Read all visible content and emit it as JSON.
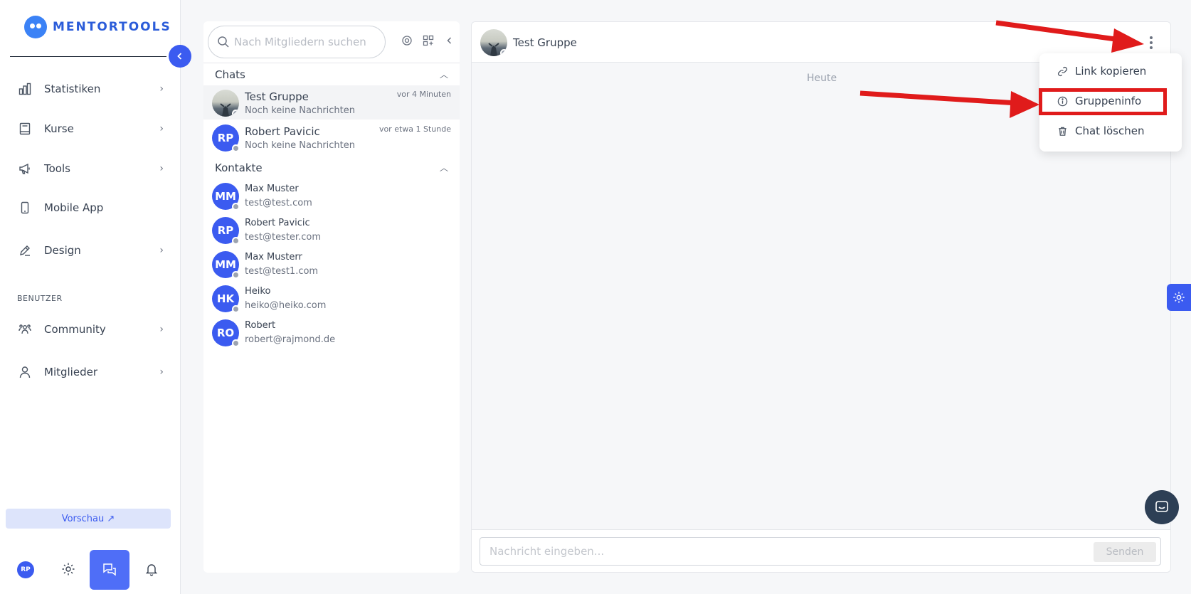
{
  "brand": {
    "name": "MENTORTOOLS"
  },
  "sidebar": {
    "items": [
      {
        "label": "Statistiken",
        "icon": "bar-chart-icon",
        "chevron": true
      },
      {
        "label": "Kurse",
        "icon": "book-icon",
        "chevron": true
      },
      {
        "label": "Tools",
        "icon": "megaphone-icon",
        "chevron": true
      },
      {
        "label": "Mobile App",
        "icon": "phone-icon",
        "chevron": false
      },
      {
        "label": "Design",
        "icon": "pencil-icon",
        "chevron": true
      },
      {
        "label": "Community",
        "icon": "users-icon",
        "chevron": true
      },
      {
        "label": "Mitglieder",
        "icon": "user-icon",
        "chevron": true
      }
    ],
    "section_label": "BENUTZER",
    "preview_label": "Vorschau ↗",
    "user_initials": "RP"
  },
  "chat_list": {
    "search_placeholder": "Nach Mitgliedern suchen",
    "chats_header": "Chats",
    "contacts_header": "Kontakte",
    "chats": [
      {
        "name": "Test Gruppe",
        "sub": "Noch keine Nachrichten",
        "time": "vor 4 Minuten",
        "initials": "",
        "photo": true
      },
      {
        "name": "Robert Pavicic",
        "sub": "Noch keine Nachrichten",
        "time": "vor etwa 1 Stunde",
        "initials": "RP",
        "photo": false
      }
    ],
    "contacts": [
      {
        "name": "Max Muster",
        "email": "test@test.com",
        "initials": "MM"
      },
      {
        "name": "Robert Pavicic",
        "email": "test@tester.com",
        "initials": "RP"
      },
      {
        "name": "Max Musterr",
        "email": "test@test1.com",
        "initials": "MM"
      },
      {
        "name": "Heiko",
        "email": "heiko@heiko.com",
        "initials": "HK"
      },
      {
        "name": "Robert",
        "email": "robert@rajmond.de",
        "initials": "RO"
      }
    ]
  },
  "conversation": {
    "title": "Test Gruppe",
    "date_separator": "Heute",
    "input_placeholder": "Nachricht eingeben...",
    "send_label": "Senden"
  },
  "menu": {
    "items": [
      {
        "label": "Link kopieren",
        "icon": "link-icon"
      },
      {
        "label": "Gruppeninfo",
        "icon": "info-icon"
      },
      {
        "label": "Chat löschen",
        "icon": "trash-icon"
      }
    ]
  },
  "colors": {
    "accent": "#3b5bf0",
    "annotation": "#e01b1b"
  }
}
